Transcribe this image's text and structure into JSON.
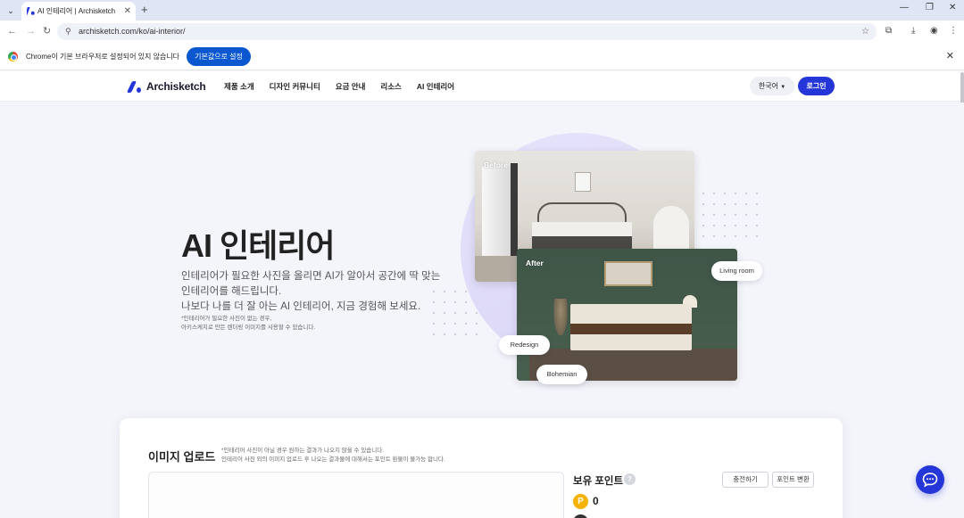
{
  "browser": {
    "tab_title": "AI 인테리어 | Archisketch",
    "url": "archisketch.com/ko/ai-interior/",
    "infobar_text": "Chrome이 기본 브라우저로 설정되어 있지 않습니다",
    "infobar_button": "기본값으로 설정"
  },
  "header": {
    "logo": "Archisketch",
    "nav": [
      "제품 소개",
      "디자인 커뮤니티",
      "요금 안내",
      "리소스",
      "AI 인테리어"
    ],
    "language": "한국어",
    "login": "로그인"
  },
  "hero": {
    "title": "AI 인테리어",
    "desc_line1": "인테리어가 필요한 사진을 올리면 AI가 알아서 공간에 딱 맞는",
    "desc_line2": "인테리어를 해드립니다.",
    "desc_line3": "나보다 나를 더 잘 아는 AI 인테리어, 지금 경험해 보세요.",
    "note_line1": "*인테리어가 필요한 사진이 없는 경우,",
    "note_line2": "아키스케치로 만든 렌더링 이미지를 사용할 수 있습니다.",
    "before_label": "Before",
    "after_label": "After",
    "chips": {
      "living_room": "Living room",
      "redesign": "Redesign",
      "bohemian": "Bohemian"
    }
  },
  "upload": {
    "title": "이미지 업로드",
    "note_line1": "*인테리어 사진이 아닐 경우 원하는 결과가 나오지 않을 수 있습니다.",
    "note_line2": "인테리어 사진 외의 이미지 업로드 후 나오는 결과물에 대해서는 포인트 환불이 불가능 합니다.",
    "points_title": "보유 포인트",
    "help": "?",
    "charge": "충전하기",
    "convert": "포인트 변환",
    "point_symbol": "P",
    "point_value": "0"
  },
  "colors": {
    "brand": "#2536d9",
    "chrome_blue": "#0b57d0",
    "point": "#f5b300"
  }
}
